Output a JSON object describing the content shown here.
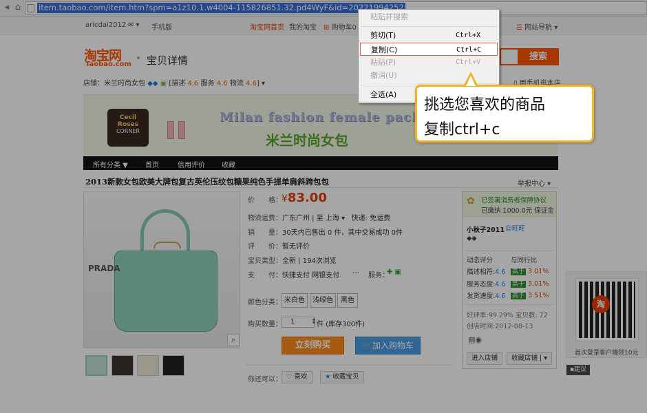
{
  "address_bar": {
    "url": "item.taobao.com/item.htm?spm=a1z10.1.w4004-115826851.32.pd4WyF&id=20221994252"
  },
  "top_nav": {
    "user": "aricdai2012",
    "mail_icon": "mail-icon",
    "mobile": "手机版",
    "home": "淘宝网首页",
    "my_taobao": "我的淘宝",
    "cart": "购物车0",
    "site_nav": "网站导航"
  },
  "header": {
    "logo_cn": "淘宝网",
    "logo_en": "Taobao.com",
    "page_title": "宝贝详情",
    "search_button": "搜索",
    "mobile_store": "用手机逛本店"
  },
  "shop_line": {
    "shop_label": "店铺：",
    "shop_name": "米兰时尚女包",
    "desc_label": "描述",
    "desc_score": "4.6",
    "service_label": "服务",
    "service_score": "4.6",
    "ship_label": "物流",
    "ship_score": "4.6"
  },
  "banner": {
    "badge_line1": "Cecil",
    "badge_line2": "Roses",
    "badge_line3": "CORNER",
    "english": "Milan fashion female pack",
    "chinese": "米兰时尚女包"
  },
  "shop_nav": {
    "all": "所有分类 ▼",
    "home": "首页",
    "reviews": "信用评价",
    "fav": "收藏"
  },
  "product": {
    "title": "2013新款女包欧美大牌包复古英伦压纹包糖果纯色手提单肩斜跨包包",
    "report": "举报中心",
    "brand_on_bag": "PRADA",
    "price_label": "价　　格：",
    "price_sign": "¥",
    "price": "83.00",
    "shipping_label": "物流运费：",
    "shipping_value": "广东广州 | 至  上海",
    "shipping_fee": "快递: 免运费",
    "sales_label": "销　　量：",
    "sales_value": "30天内已售出 0 件，其中交易成功 0件",
    "rating_label": "评　　价：",
    "rating_value": "暂无评价",
    "type_label": "宝贝类型：",
    "type_value": "全新  |  194次浏览",
    "pay_label": "支　　付：",
    "pay_value": "快捷支付   网银支付",
    "service_label": "服务：",
    "color_label": "颜色分类：",
    "colors": [
      "米白色",
      "浅绿色",
      "黑色"
    ],
    "qty_label": "购买数量：",
    "qty_value": "1",
    "stock": "件 (库存300件)",
    "buy_now": "立刻购买",
    "add_cart": "加入购物车",
    "may_like": "你还可以：",
    "like_btn": "喜欢",
    "fav_btn": "收藏宝贝"
  },
  "seller": {
    "guarantee": "已签署消费者保障协议",
    "deposit": "已缴纳 1000.0元 保证金",
    "name": "小秋子2011",
    "dynamic": "动态评分",
    "compare": "与同行比",
    "rows": [
      {
        "label": "描述相符:",
        "score": "4.6",
        "badge": "高于",
        "pct": "3.01%"
      },
      {
        "label": "服务态度:",
        "score": "4.6",
        "badge": "高于",
        "pct": "3.01%"
      },
      {
        "label": "发货速度:",
        "score": "4.6",
        "badge": "高于",
        "pct": "3.51%"
      }
    ],
    "good_rate": "好评率:99.29%  宝贝数: 72",
    "created": "创店时间:2012-08-13",
    "enter_shop": "进入店铺",
    "fav_shop": "收藏店铺"
  },
  "qr": {
    "center": "淘",
    "text": "首次登录客户端领10元"
  },
  "suggest": "建议",
  "context_menu": {
    "paste_search": "粘贴并搜索",
    "items": [
      {
        "label": "剪切(T)",
        "key": "Ctrl+X",
        "state": "enabled"
      },
      {
        "label": "复制(C)",
        "key": "Ctrl+C",
        "state": "highlighted"
      },
      {
        "label": "粘贴(P)",
        "key": "Ctrl+V",
        "state": "disabled"
      },
      {
        "label": "撤消(U)",
        "key": "",
        "state": "disabled"
      },
      {
        "label": "全选(A)",
        "key": "",
        "state": "enabled"
      }
    ]
  },
  "callout": {
    "line1": "挑选您喜欢的商品",
    "line2": "复制ctrl+c"
  }
}
